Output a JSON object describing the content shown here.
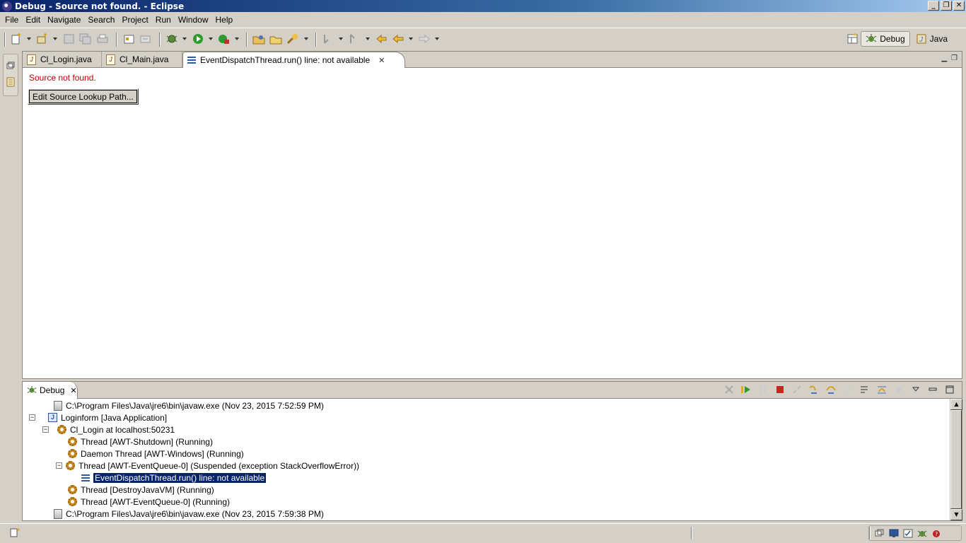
{
  "window": {
    "title": "Debug - Source not found. - Eclipse",
    "controls": {
      "minimize": "_",
      "restore": "❐",
      "close": "✕"
    }
  },
  "menu": [
    "File",
    "Edit",
    "Navigate",
    "Search",
    "Project",
    "Run",
    "Window",
    "Help"
  ],
  "perspectives": {
    "debug_label": "Debug",
    "java_label": "Java"
  },
  "editor": {
    "tabs": [
      {
        "label": "Cl_Login.java",
        "icon": "java-file-icon"
      },
      {
        "label": "Cl_Main.java",
        "icon": "java-file-icon"
      },
      {
        "label": "EventDispatchThread.run() line: not available",
        "icon": "stack-frame-icon",
        "active": true
      }
    ],
    "message": "Source not found.",
    "edit_lookup_button": "Edit Source Lookup Path..."
  },
  "debug_view": {
    "tab_label": "Debug",
    "tree": [
      {
        "label": "C:\\Program Files\\Java\\jre6\\bin\\javaw.exe (Nov 23, 2015 7:52:59 PM)",
        "icon": "process-icon"
      },
      {
        "label": "Loginform [Java Application]",
        "icon": "java-app-icon",
        "expander": "−"
      },
      {
        "label": "Cl_Login at localhost:50231",
        "icon": "debug-target-icon",
        "expander": "−"
      },
      {
        "label": "Thread [AWT-Shutdown] (Running)",
        "icon": "running-thread-icon"
      },
      {
        "label": "Daemon Thread [AWT-Windows] (Running)",
        "icon": "running-thread-icon"
      },
      {
        "label": "Thread [AWT-EventQueue-0] (Suspended (exception StackOverflowError))",
        "icon": "suspended-thread-icon",
        "expander": "−"
      },
      {
        "label": "EventDispatchThread.run() line: not available",
        "icon": "stack-frame-icon",
        "selected": true
      },
      {
        "label": "Thread [DestroyJavaVM] (Running)",
        "icon": "running-thread-icon"
      },
      {
        "label": "Thread [AWT-EventQueue-0] (Running)",
        "icon": "running-thread-icon"
      },
      {
        "label": "C:\\Program Files\\Java\\jre6\\bin\\javaw.exe (Nov 23, 2015 7:59:38 PM)",
        "icon": "process-icon"
      }
    ]
  },
  "colors": {
    "title_start": "#0a246a",
    "error_text": "#c00000",
    "selection": "#0a246a",
    "chrome": "#d4d0c8"
  }
}
